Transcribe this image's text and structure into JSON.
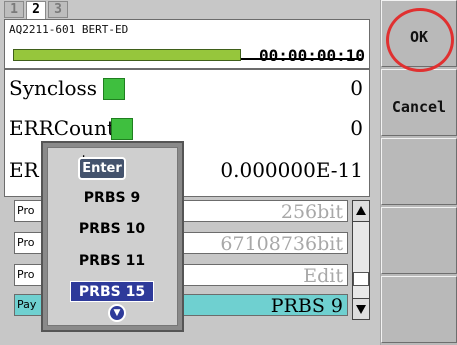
{
  "tabs": [
    {
      "label": "1",
      "active": false
    },
    {
      "label": "2",
      "active": true
    },
    {
      "label": "3",
      "active": false
    }
  ],
  "instrument": {
    "title": "AQ2211-601 BERT-ED",
    "timer": "00:00:00:10",
    "progress_fraction": 0.65
  },
  "stats": [
    {
      "label": "Syncloss",
      "value": "0",
      "led_color": "#3fbf3f"
    },
    {
      "label": "ERRCount",
      "value": "0",
      "led_color": "#3fbf3f"
    },
    {
      "label": "ER",
      "value": "0.000000E-11"
    }
  ],
  "params": [
    {
      "label": "Pro",
      "value": "256bit"
    },
    {
      "label": "Pro",
      "value": "67108736bit"
    },
    {
      "label": "Pro",
      "value": "Edit"
    },
    {
      "label": "Pay",
      "value": "PRBS 9",
      "selected": true
    }
  ],
  "popup": {
    "enter_label": "Enter",
    "options": [
      "PRBS 9",
      "PRBS 10",
      "PRBS 11",
      "PRBS 15"
    ],
    "highlighted": "PRBS 15"
  },
  "softkeys": {
    "ok": "OK",
    "cancel": "Cancel"
  },
  "colors": {
    "progress": "#96c63c",
    "highlight": "#2e3a9a",
    "selected_row": "#6fd0d0",
    "callout": "#e03030"
  },
  "icons": [
    "scroll-up-icon",
    "scroll-down-icon",
    "more-down-icon"
  ]
}
